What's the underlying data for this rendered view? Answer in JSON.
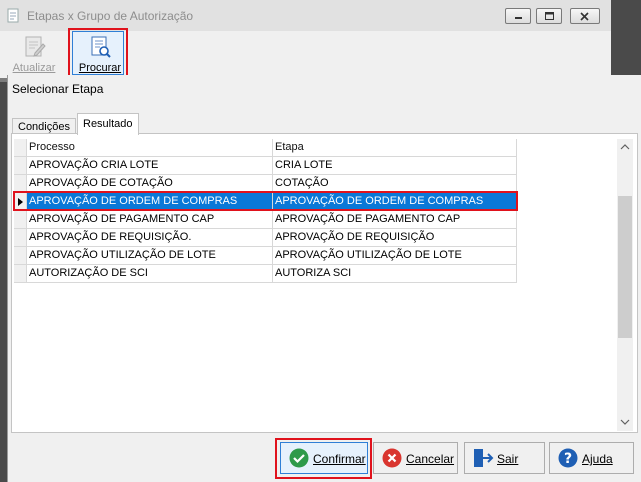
{
  "outer_window": {
    "title": "Etapas x Grupo de Autorização",
    "toolbar": {
      "atualizar_label": "Atualizar",
      "procurar_label": "Procurar"
    }
  },
  "dialog": {
    "title": "Selecionar Etapa",
    "tabs": [
      {
        "label": "Condições",
        "active": false
      },
      {
        "label": "Resultado",
        "active": true
      }
    ],
    "grid": {
      "columns": [
        "Processo",
        "Etapa"
      ],
      "rows": [
        {
          "processo": "APROVAÇÃO CRIA LOTE",
          "etapa": "CRIA LOTE",
          "selected": false
        },
        {
          "processo": "APROVAÇÃO DE COTAÇÃO",
          "etapa": "COTAÇÃO",
          "selected": false
        },
        {
          "processo": "APROVAÇÃO DE ORDEM DE COMPRAS",
          "etapa": "APROVAÇÃO DE ORDEM DE COMPRAS",
          "selected": true
        },
        {
          "processo": "APROVAÇÃO DE PAGAMENTO CAP",
          "etapa": "APROVAÇÃO DE PAGAMENTO CAP",
          "selected": false
        },
        {
          "processo": "APROVAÇÃO DE REQUISIÇÃO.",
          "etapa": "APROVAÇÃO DE REQUISIÇÃO",
          "selected": false
        },
        {
          "processo": "APROVAÇÃO UTILIZAÇÃO DE LOTE",
          "etapa": "APROVAÇÃO UTILIZAÇÃO DE LOTE",
          "selected": false
        },
        {
          "processo": "AUTORIZAÇÃO DE SCI",
          "etapa": "AUTORIZA SCI",
          "selected": false
        }
      ]
    },
    "buttons": {
      "confirmar_label": "Confirmar",
      "cancelar_label": "Cancelar",
      "sair_label": "Sair",
      "ajuda_label": "Ajuda"
    }
  },
  "icons": {
    "app": "app-icon",
    "atualizar": "edit-document-icon",
    "procurar": "search-document-icon",
    "confirmar": "check-circle-icon",
    "cancelar": "x-circle-icon",
    "sair": "exit-door-icon",
    "ajuda": "help-circle-icon"
  },
  "colors": {
    "selection": "#0a78d7",
    "highlight_box": "#e0121c",
    "confirm_green": "#2e9a4a",
    "cancel_red": "#d9352f",
    "help_blue": "#1f5fb4"
  }
}
